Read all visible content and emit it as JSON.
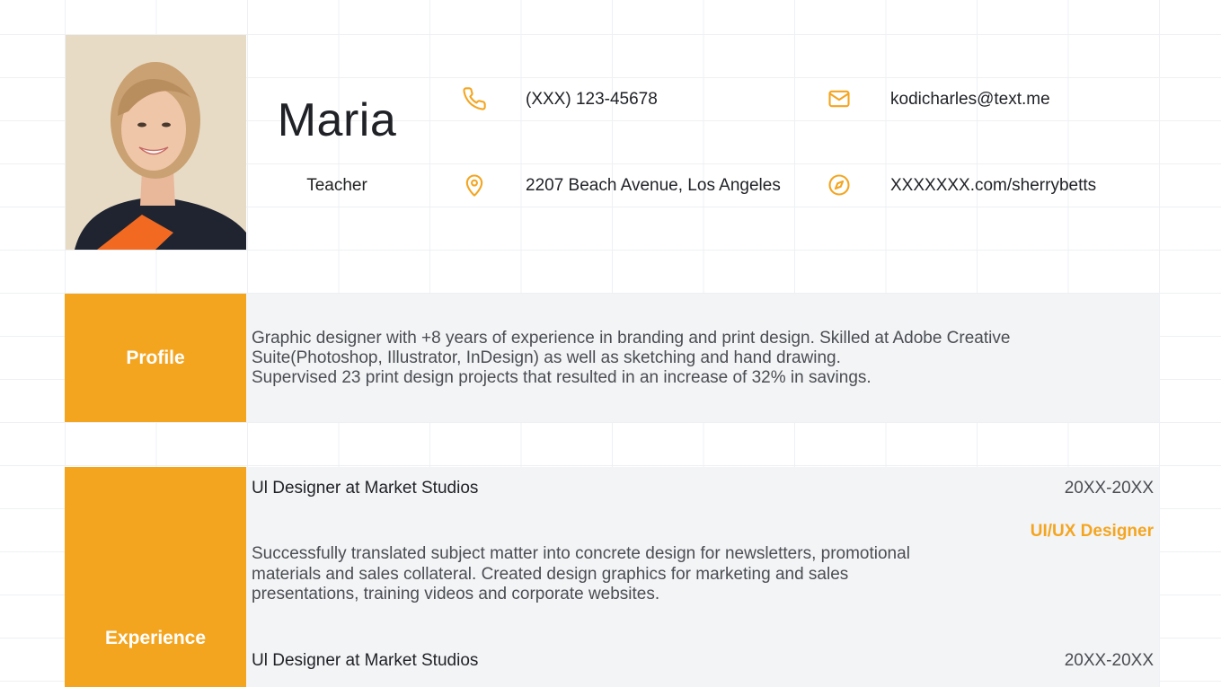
{
  "header": {
    "name": "Maria",
    "role": "Teacher",
    "photo_alt": "Portrait photo"
  },
  "contacts": {
    "phone": "(XXX) 123-45678",
    "email": "kodicharles@text.me",
    "address": "2207 Beach Avenue, Los Angeles",
    "website": "XXXXXXX.com/sherrybetts",
    "icons": [
      "phone-icon",
      "mail-icon",
      "location-pin-icon",
      "compass-icon"
    ]
  },
  "profile": {
    "label": "Profile",
    "lines": [
      "Graphic designer with +8 years of experience in branding and print design. Skilled at Adobe Creative",
      "Suite(Photoshop, Illustrator, InDesign) as well as sketching and hand drawing.",
      "Supervised 23 print design projects that resulted in an increase of 32% in savings."
    ]
  },
  "experience": {
    "label": "Experience",
    "jobs": [
      {
        "title": "Ul Designer at Market Studios",
        "dates": "20XX-20XX",
        "role": "UI/UX Designer",
        "description": [
          "Successfully translated subject matter into concrete design for newsletters, promotional",
          "materials and sales collateral. Created design graphics for marketing and sales",
          "presentations, training videos and corporate websites."
        ]
      },
      {
        "title": "Ul Designer at Market Studios",
        "dates": "20XX-20XX"
      }
    ]
  },
  "colors": {
    "accent": "#f4a520",
    "panel": "#f3f4f6",
    "text": "#1f2126",
    "muted": "#4a4d52"
  }
}
